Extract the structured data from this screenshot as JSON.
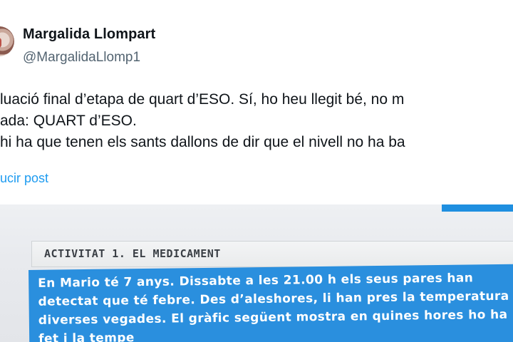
{
  "author": {
    "display_name": "Margalida Llompart",
    "handle": "@MargalidaLlomp1"
  },
  "tweet": {
    "lines": [
      "luació final d’etapa de quart d’ESO. Sí, ho heu llegit bé, no m",
      "ada: QUART d’ESO.",
      "hi ha que tenen els sants dallons de dir que el nivell no ha ba"
    ],
    "translate_label": "ucir post"
  },
  "photo": {
    "activity_title": "ACTIVITAT 1. EL MEDICAMENT",
    "problem_lines": [
      "En Mario té 7 anys. Dissabte a les 21.00 h els seus pares han",
      "detectat que té febre. Des d’aleshores, li han pres la temperatura",
      "diverses vegades. El gràfic següent mostra en quines hores ho ha",
      "fet i la tempe"
    ],
    "colors": {
      "box_blue": "#2a8fde",
      "link_blue": "#1d9bf0"
    }
  }
}
